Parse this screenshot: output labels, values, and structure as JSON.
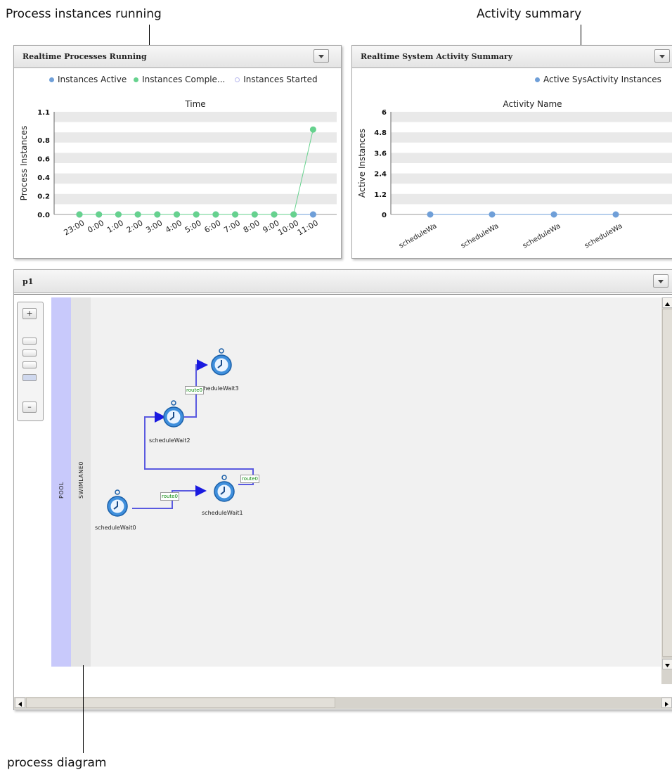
{
  "callouts": {
    "process_running": "Process instances running",
    "activity_summary": "Activity summary",
    "process_diagram": "process diagram"
  },
  "colors": {
    "instances_active": "#6f9fd8",
    "instances_completed": "#66d28e",
    "instances_started": "#c9c9f5",
    "pool": "#c8c9fb",
    "route_text": "#0b8a0b",
    "connector": "#5a5ae0"
  },
  "panel_processes": {
    "title": "Realtime Processes Running",
    "menu_icon": "chevron-down-icon",
    "legend": [
      "Instances Active",
      "Instances Comple...",
      "Instances Started"
    ]
  },
  "panel_activity": {
    "title": "Realtime System Activity Summary",
    "menu_icon": "chevron-down-icon",
    "legend": [
      "Active SysActivity Instances"
    ]
  },
  "panel_diagram": {
    "title": "p1",
    "menu_icon": "chevron-down-icon",
    "zoom": {
      "plus": "+",
      "minus": "–"
    },
    "pool_label": "POOL",
    "lane_label": "SWIMLANE0",
    "tasks": [
      "scheduleWait0",
      "scheduleWait1",
      "scheduleWait2",
      "scheduleWait3"
    ],
    "task_icon": "stopwatch-icon",
    "routes": [
      "route0",
      "route0",
      "route0"
    ]
  },
  "chart_data": [
    {
      "type": "line",
      "title": "Time",
      "xlabel": "",
      "ylabel": "Process Instances",
      "categories": [
        "23:00",
        "0:00",
        "1:00",
        "2:00",
        "3:00",
        "4:00",
        "5:00",
        "6:00",
        "7:00",
        "8:00",
        "9:00",
        "10:00",
        "11:00"
      ],
      "ylim": [
        0,
        1.1
      ],
      "yticks": [
        "1.1",
        "0.8",
        "0.6",
        "0.4",
        "0.2",
        "0.0"
      ],
      "series": [
        {
          "name": "Instances Active",
          "values": [
            0,
            0,
            0,
            0,
            0,
            0,
            0,
            0,
            0,
            0,
            0,
            0,
            0
          ]
        },
        {
          "name": "Instances Comple...",
          "values": [
            0,
            0,
            0,
            0,
            0,
            0,
            0,
            0,
            0,
            0,
            0,
            0,
            0
          ]
        },
        {
          "name": "Instances Started",
          "values": [
            0,
            0,
            0,
            0,
            0,
            0,
            0,
            0,
            0,
            0,
            0,
            0,
            0.91
          ]
        }
      ],
      "grid": true,
      "legend": "top"
    },
    {
      "type": "line",
      "title": "Activity Name",
      "xlabel": "",
      "ylabel": "Active Instances",
      "categories": [
        "scheduleWa",
        "scheduleWa",
        "scheduleWa",
        "scheduleWa"
      ],
      "ylim": [
        0,
        6
      ],
      "yticks": [
        "6",
        "4.8",
        "3.6",
        "2.4",
        "1.2",
        "0"
      ],
      "series": [
        {
          "name": "Active SysActivity Instances",
          "values": [
            0,
            0,
            0,
            0
          ]
        }
      ],
      "grid": true,
      "legend": "top-right"
    }
  ]
}
